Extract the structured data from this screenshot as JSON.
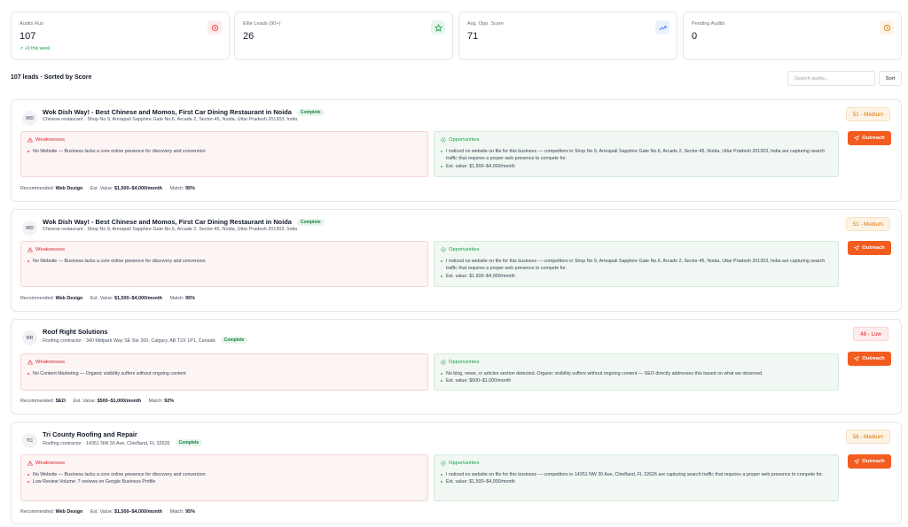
{
  "stats": [
    {
      "label": "Audits Run",
      "value": "107",
      "sub": "+0 this week",
      "icon": "target-icon",
      "color": "#ef4444",
      "bg": "#fdecec"
    },
    {
      "label": "Elite Leads (90+)",
      "value": "26",
      "sub": "",
      "icon": "star-icon",
      "color": "#16a34a",
      "bg": "#e8f6ee"
    },
    {
      "label": "Avg. Opp. Score",
      "value": "71",
      "sub": "",
      "icon": "trending-up-icon",
      "color": "#3b82f6",
      "bg": "#eaf1fd"
    },
    {
      "label": "Pending Audits",
      "value": "0",
      "sub": "",
      "icon": "clock-icon",
      "color": "#d97706",
      "bg": "#fdf3e5"
    }
  ],
  "list": {
    "title": "107 leads · Sorted by Score",
    "search_placeholder": "Search audits...",
    "sort_label": "Sort"
  },
  "labels": {
    "complete": "Complete",
    "weaknesses": "Weaknesses",
    "opportunities": "Opportunities",
    "outreach": "Outreach",
    "recommended": "Recommended:",
    "est_value": "Est. Value:",
    "match": "Match:"
  },
  "leads": [
    {
      "initials": "WD",
      "name": "Wok Dish Way! - Best Chinese and Momos, First Car Dining Restaurant in Noida",
      "address": "Chinese restaurant · Shop No 9, Amrapali Sapphire Gate No.6, Arcade 2, Sector-45, Noida, Uttar Pradesh 201303, India",
      "score": "51 - Medium",
      "level": "medium",
      "weaknesses": [
        "No Website — Business lacks a core online presence for discovery and conversion"
      ],
      "opportunities": [
        "I noticed no website on file for this business — competitors in Shop No 9, Amrapali Sapphire Gate No.6, Arcade 2, Sector-45, Noida, Uttar Pradesh 201303, India are capturing search traffic that requires a proper web presence to compete for.",
        "Est. value: $1,500–$4,000/month"
      ],
      "recommended": "Web Design",
      "est_value": "$1,500–$4,000/month",
      "match": "95%"
    },
    {
      "initials": "WD",
      "name": "Wok Dish Way! - Best Chinese and Momos, First Car Dining Restaurant in Noida",
      "address": "Chinese restaurant · Shop No 9, Amrapali Sapphire Gate No.6, Arcade 2, Sector-45, Noida, Uttar Pradesh 201303, India",
      "score": "51 - Medium",
      "level": "medium",
      "weaknesses": [
        "No Website — Business lacks a core online presence for discovery and conversion"
      ],
      "opportunities": [
        "I noticed no website on file for this business — competitors in Shop No 9, Amrapali Sapphire Gate No.6, Arcade 2, Sector-45, Noida, Uttar Pradesh 201303, India are capturing search traffic that requires a proper web presence to compete for.",
        "Est. value: $1,500–$4,000/month"
      ],
      "recommended": "Web Design",
      "est_value": "$1,500–$4,000/month",
      "match": "95%"
    },
    {
      "initials": "RR",
      "name": "Roof Right Solutions",
      "address": "Roofing contractor · 340 Midpark Way SE Ste 300, Calgary, AB T2X 1P1, Canada",
      "score": "48 - Low",
      "level": "low",
      "weaknesses": [
        "No Content Marketing — Organic visibility suffers without ongoing content"
      ],
      "opportunities": [
        "No blog, news, or articles section detected. Organic visibility suffers without ongoing content — SEO directly addresses this based on what we observed.",
        "Est. value: $500–$1,000/month"
      ],
      "recommended": "SEO",
      "est_value": "$500–$1,000/month",
      "match": "92%"
    },
    {
      "initials": "TC",
      "name": "Tri County Roofing and Repair",
      "address": "Roofing contractor · 14351 NW 30 Ave, Chiefland, FL 32626",
      "score": "56 - Medium",
      "level": "medium",
      "weaknesses": [
        "No Website — Business lacks a core online presence for discovery and conversion",
        "Low Review Volume: 7 reviews on Google Business Profile"
      ],
      "opportunities": [
        "I noticed no website on file for this business — competitors in 14351 NW 30 Ave, Chiefland, FL 32626 are capturing search traffic that requires a proper web presence to compete for.",
        "Est. value: $1,500–$4,000/month"
      ],
      "recommended": "Web Design",
      "est_value": "$1,500–$4,000/month",
      "match": "95%"
    }
  ]
}
